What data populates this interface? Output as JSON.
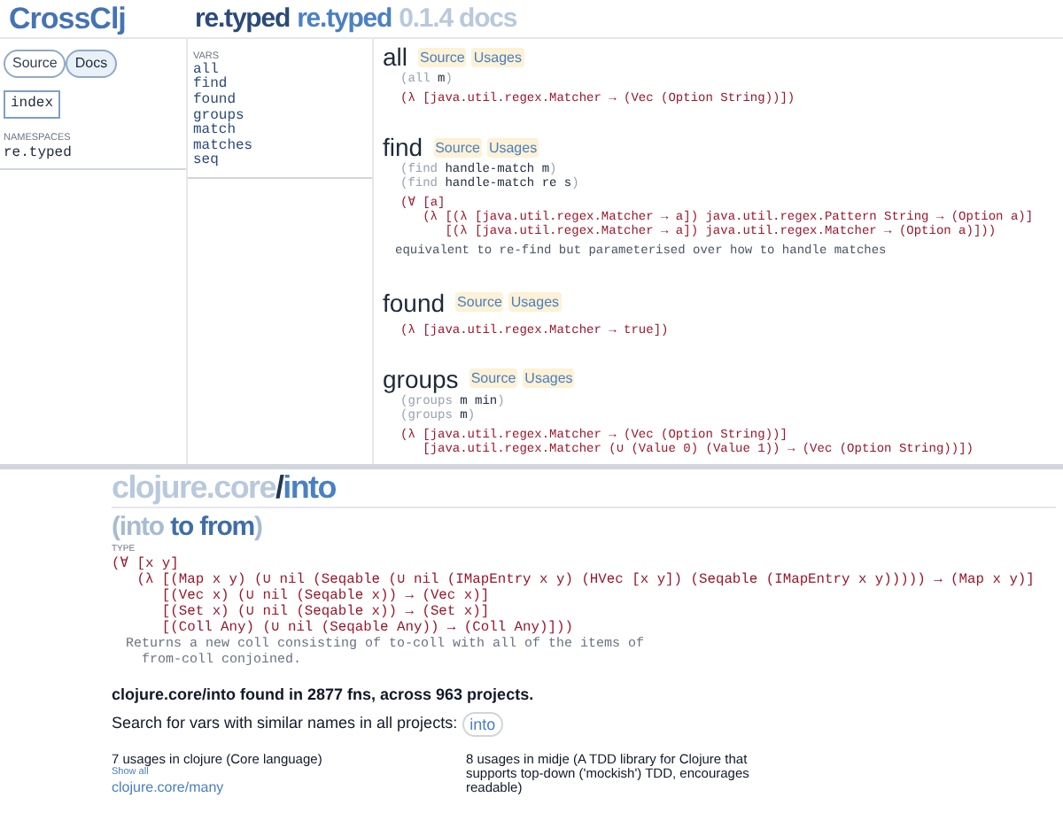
{
  "header": {
    "logo": "CrossClj",
    "title_parts": [
      {
        "text": "re.typed",
        "kind": "dark"
      },
      {
        "text": "re.typed",
        "kind": "blue"
      },
      {
        "text": "0.1.4 docs",
        "kind": "light"
      }
    ]
  },
  "sidebar": {
    "buttons": [
      {
        "label": "Source",
        "selected": false
      },
      {
        "label": "Docs",
        "selected": true
      }
    ],
    "index_button": "index",
    "namespaces_label": "NAMESPACES",
    "namespaces": [
      "re.typed"
    ]
  },
  "vars": {
    "label": "VARS",
    "items": [
      "all",
      "find",
      "found",
      "groups",
      "match",
      "matches",
      "seq"
    ]
  },
  "entries": [
    {
      "name": "all",
      "links": [
        "Source",
        "Usages"
      ],
      "arglists": [
        [
          {
            "text": "(all ",
            "kind": "punct"
          },
          {
            "text": "m",
            "kind": "arg"
          },
          {
            "text": ")",
            "kind": "punct"
          }
        ]
      ],
      "type": "(λ [java.util.regex.Matcher → (Vec (Option String))])"
    },
    {
      "name": "find",
      "links": [
        "Source",
        "Usages"
      ],
      "arglists": [
        [
          {
            "text": "(find ",
            "kind": "punct"
          },
          {
            "text": "handle-match m",
            "kind": "arg"
          },
          {
            "text": ")",
            "kind": "punct"
          }
        ],
        [
          {
            "text": "(find ",
            "kind": "punct"
          },
          {
            "text": "handle-match re s",
            "kind": "arg"
          },
          {
            "text": ")",
            "kind": "punct"
          }
        ]
      ],
      "type": "(∀ [a]\n   (λ [(λ [java.util.regex.Matcher → a]) java.util.regex.Pattern String → (Option a)]\n      [(λ [java.util.regex.Matcher → a]) java.util.regex.Matcher → (Option a)]))",
      "doc": "equivalent to re-find but parameterised over how to handle matches"
    },
    {
      "name": "found",
      "links": [
        "Source",
        "Usages"
      ],
      "type": "(λ [java.util.regex.Matcher → true])"
    },
    {
      "name": "groups",
      "links": [
        "Source",
        "Usages"
      ],
      "arglists": [
        [
          {
            "text": "(groups ",
            "kind": "punct"
          },
          {
            "text": "m min",
            "kind": "arg"
          },
          {
            "text": ")",
            "kind": "punct"
          }
        ],
        [
          {
            "text": "(groups ",
            "kind": "punct"
          },
          {
            "text": "m",
            "kind": "arg"
          },
          {
            "text": ")",
            "kind": "punct"
          }
        ]
      ],
      "type": "(λ [java.util.regex.Matcher → (Vec (Option String))]\n   [java.util.regex.Matcher (∪ (Value 0) (Value 1)) → (Vec (Option String))])"
    }
  ],
  "detail": {
    "title_parts": [
      {
        "text": "clojure.core",
        "kind": "light"
      },
      {
        "text": "/",
        "kind": "dark"
      },
      {
        "text": "into",
        "kind": "blue"
      }
    ],
    "signature": [
      {
        "text": "(into ",
        "kind": "punct"
      },
      {
        "text": "to from",
        "kind": "arg"
      },
      {
        "text": ")",
        "kind": "punct"
      }
    ],
    "type_label": "TYPE",
    "type": "(∀ [x y]\n   (λ [(Map x y) (∪ nil (Seqable (∪ nil (IMapEntry x y) (HVec [x y]) (Seqable (IMapEntry x y))))) → (Map x y)]\n      [(Vec x) (∪ nil (Seqable x)) → (Vec x)]\n      [(Set x) (∪ nil (Seqable x)) → (Set x)]\n      [(Coll Any) (∪ nil (Seqable Any)) → (Coll Any)]))",
    "doc": "Returns a new coll consisting of to-coll with all of the items of\n  from-coll conjoined.",
    "found": "clojure.core/into found in 2877 fns, across 963 projects.",
    "search_text": "Search for vars with similar names in all projects:",
    "search_pill": "into",
    "usages": [
      {
        "title": "7 usages in clojure (Core language)",
        "show_all": "Show all",
        "items": [
          "clojure.core/many"
        ]
      },
      {
        "title": "8 usages in midje (A TDD library for Clojure that supports top-down ('mockish') TDD, encourages readable)"
      }
    ]
  }
}
